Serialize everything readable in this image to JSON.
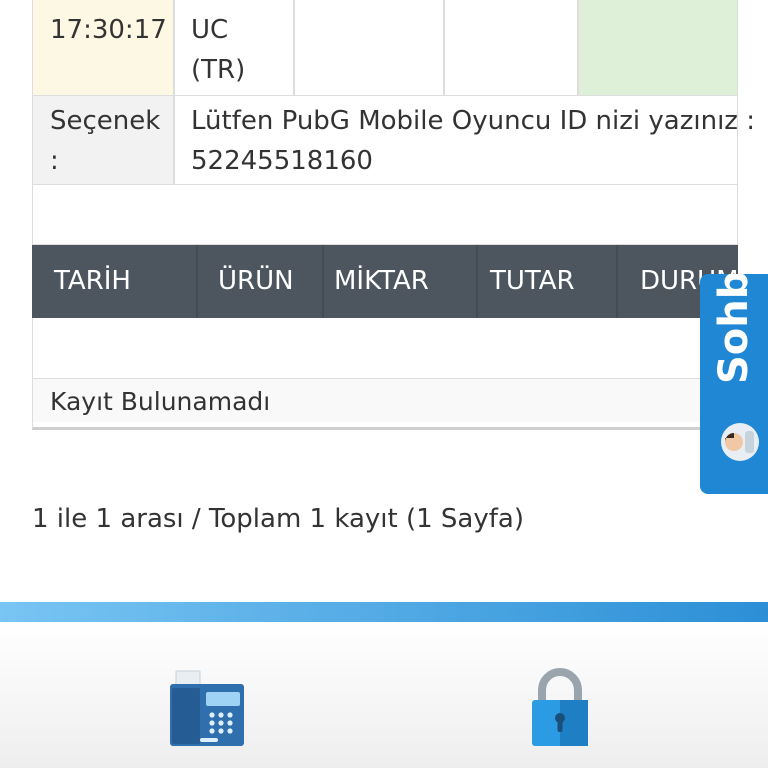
{
  "order": {
    "time": "17:30:17",
    "time_top_partial": "",
    "product_line1": "UC",
    "product_line2": "(TR)",
    "option_label_line1": "Seçenek",
    "option_label_line2": ":",
    "option_value_line1": "Lütfen PubG Mobile Oyuncu ID nizi yazınız :",
    "option_value_line2": "52245518160"
  },
  "history_table": {
    "headers": [
      "TARİH",
      "ÜRÜN",
      "MİKTAR",
      "TUTAR",
      "DURUM"
    ],
    "empty_message": "Kayıt Bulunamadı"
  },
  "pagination": {
    "summary": "1 ile 1 arası / Toplam 1 kayıt (1 Sayfa)"
  },
  "chat_widget": {
    "label": "Sohbet",
    "icon": "support-agent-icon"
  },
  "footer": {
    "items": [
      {
        "icon": "fax-phone-icon"
      },
      {
        "icon": "lock-icon"
      }
    ]
  },
  "colors": {
    "header_bg": "#4d565f",
    "accent_blue": "#1f87d3",
    "time_cell_bg": "#fcf8e3",
    "status_cell_bg": "#dff0d8"
  }
}
